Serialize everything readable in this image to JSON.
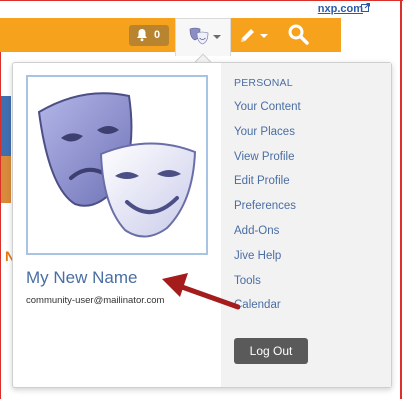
{
  "header": {
    "site_link": "nxp.com",
    "notifications_count": "0"
  },
  "profile": {
    "name": "My New Name",
    "email": "community-user@mailinator.com"
  },
  "menu": {
    "section_label": "PERSONAL",
    "items": [
      "Your Content",
      "Your Places",
      "View Profile",
      "Edit Profile",
      "Preferences",
      "Add-Ons",
      "Jive Help",
      "Tools",
      "Calendar"
    ],
    "logout_label": "Log Out"
  },
  "colors": {
    "toolbar": "#f6a21c",
    "link": "#4a6ea3",
    "logout_button": "#5a5a5a",
    "annotation_arrow": "#a51c1c"
  },
  "icons": [
    "bell-icon",
    "theater-masks-icon",
    "pencil-icon",
    "search-icon",
    "external-link-icon",
    "chevron-down-icon"
  ]
}
